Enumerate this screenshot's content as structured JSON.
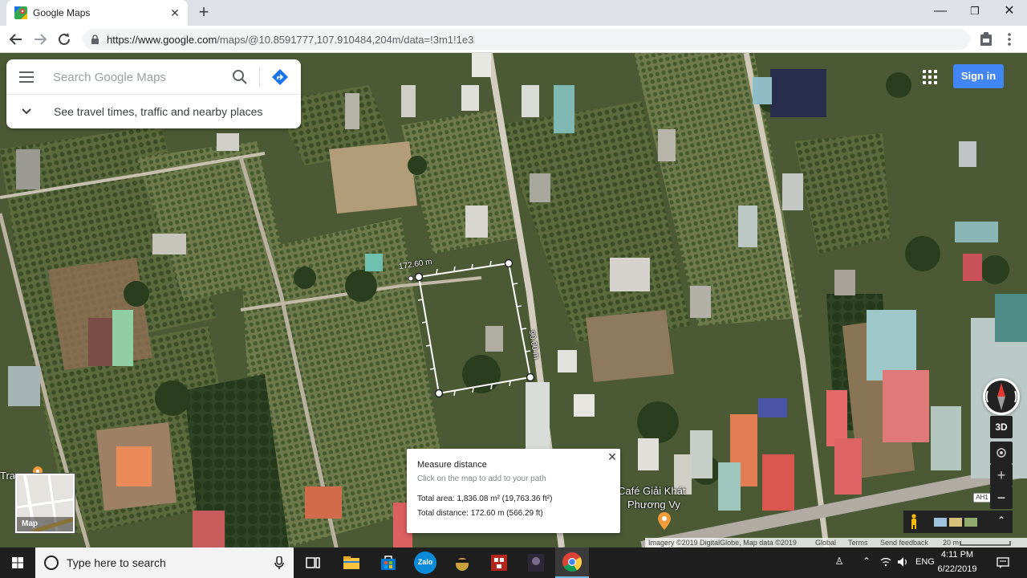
{
  "browser": {
    "tab_title": "Google Maps",
    "tab_close": "✕",
    "new_tab": "+",
    "url_host": "https://www.google.com",
    "url_path": "/maps/@10.8591777,107.910484,204m/data=!3m1!1e3",
    "window_buttons": {
      "minimize": "—",
      "maximize": "❐",
      "close": "✕"
    }
  },
  "search": {
    "placeholder": "Search Google Maps",
    "value": "",
    "travel_text": "See travel times, traffic and nearby places"
  },
  "header": {
    "sign_in": "Sign in"
  },
  "measure": {
    "segment_label_top": "172.60 m",
    "segment_label_right": "90.00 m",
    "title": "Measure distance",
    "hint": "Click on the map to add to your path",
    "total_area": "Total area: 1,836.08 m² (19,763.36 ft²)",
    "total_distance": "Total distance: 172.60 m (566.29 ft)",
    "close": "✕"
  },
  "map_labels": {
    "cafe_line1": "Café Giải Khát",
    "cafe_line2": "Phương Vy",
    "left_edge": "Tra",
    "road_shield": "AH1"
  },
  "controls": {
    "three_d": "3D",
    "zoom_in": "+",
    "zoom_out": "−",
    "minimap_label": "Map",
    "expand": "⌃"
  },
  "attribution": {
    "imagery": "Imagery ©2019 DigitalGlobe, Map data ©2019",
    "global": "Global",
    "terms": "Terms",
    "feedback": "Send feedback",
    "scale": "20 m"
  },
  "taskbar": {
    "search_placeholder": "Type here to search",
    "lang": "ENG",
    "time": "4:11 PM",
    "date": "6/22/2019",
    "zalo": "Zalo"
  },
  "colors": {
    "google_blue": "#4285f4",
    "taskbar": "#1f1f1f",
    "measure_line": "#ffffff"
  }
}
